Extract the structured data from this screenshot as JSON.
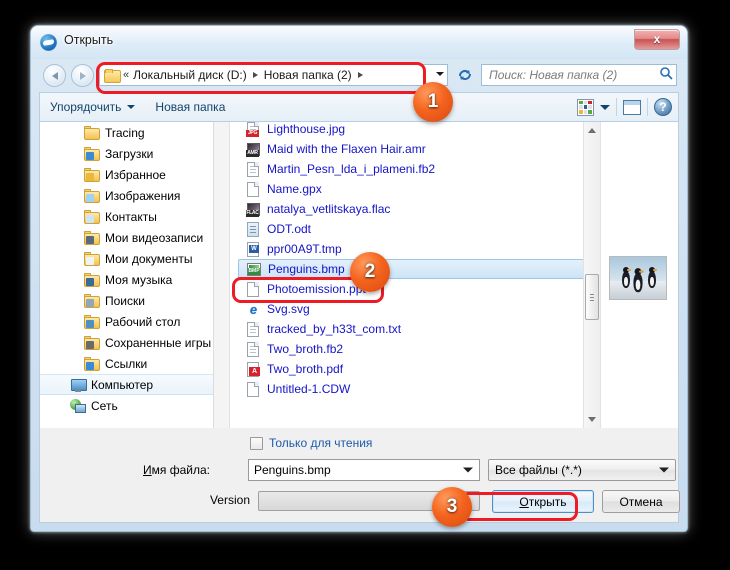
{
  "window": {
    "title": "Открыть",
    "close_label": "x"
  },
  "nav": {
    "back_title": "Назад",
    "forward_title": "Вперед",
    "breadcrumb": {
      "chevrons": "«",
      "items": [
        "Локальный диск (D:)",
        "Новая папка (2)"
      ]
    },
    "refresh_name": "refresh-icon",
    "search_placeholder": "Поиск: Новая папка (2)"
  },
  "toolbar": {
    "organize_label": "Упорядочить",
    "new_folder_label": "Новая папка",
    "views_name": "views-icon",
    "preview_pane_name": "preview-pane-icon",
    "help_label": "?"
  },
  "tree": {
    "items": [
      {
        "label": "Tracing",
        "icon": "folder-icon",
        "selected": false,
        "root": false
      },
      {
        "label": "Загрузки",
        "icon": "folder-downloads-icon",
        "selected": false,
        "root": false
      },
      {
        "label": "Избранное",
        "icon": "folder-favorites-icon",
        "selected": false,
        "root": false
      },
      {
        "label": "Изображения",
        "icon": "folder-pictures-icon",
        "selected": false,
        "root": false
      },
      {
        "label": "Контакты",
        "icon": "folder-contacts-icon",
        "selected": false,
        "root": false
      },
      {
        "label": "Мои видеозаписи",
        "icon": "folder-videos-icon",
        "selected": false,
        "root": false
      },
      {
        "label": "Мои документы",
        "icon": "folder-documents-icon",
        "selected": false,
        "root": false
      },
      {
        "label": "Моя музыка",
        "icon": "folder-music-icon",
        "selected": false,
        "root": false
      },
      {
        "label": "Поиски",
        "icon": "folder-searches-icon",
        "selected": false,
        "root": false
      },
      {
        "label": "Рабочий стол",
        "icon": "folder-desktop-icon",
        "selected": false,
        "root": false
      },
      {
        "label": "Сохраненные игры",
        "icon": "folder-savedgames-icon",
        "selected": false,
        "root": false
      },
      {
        "label": "Ссылки",
        "icon": "folder-links-icon",
        "selected": false,
        "root": false
      },
      {
        "label": "Компьютер",
        "icon": "computer-icon",
        "selected": true,
        "root": true
      },
      {
        "label": "Сеть",
        "icon": "network-icon",
        "selected": false,
        "root": true
      }
    ]
  },
  "files": {
    "items": [
      {
        "name": "Lighthouse.jpg",
        "icon": "jpg-file-icon",
        "ext": "JPG",
        "selected": false
      },
      {
        "name": "Maid with the Flaxen Hair.amr",
        "icon": "amr-file-icon",
        "ext": "AMR",
        "selected": false
      },
      {
        "name": "Martin_Pesn_lda_i_plameni.fb2",
        "icon": "text-file-icon",
        "ext": "",
        "selected": false
      },
      {
        "name": "Name.gpx",
        "icon": "blank-file-icon",
        "ext": "",
        "selected": false
      },
      {
        "name": "natalya_vetlitskaya.flac",
        "icon": "flac-file-icon",
        "ext": "FLAC",
        "selected": false
      },
      {
        "name": "ODT.odt",
        "icon": "odt-file-icon",
        "ext": "",
        "selected": false
      },
      {
        "name": "ppr00A9T.tmp",
        "icon": "tmp-file-icon",
        "ext": "",
        "selected": false
      },
      {
        "name": "Penguins.bmp",
        "icon": "bmp-file-icon",
        "ext": "BMP",
        "selected": true
      },
      {
        "name": "Photoemission.ppt",
        "icon": "blank-file-icon",
        "ext": "",
        "selected": false
      },
      {
        "name": "Svg.svg",
        "icon": "svg-file-icon",
        "ext": "",
        "selected": false
      },
      {
        "name": "tracked_by_h33t_com.txt",
        "icon": "text-file-icon",
        "ext": "",
        "selected": false
      },
      {
        "name": "Two_broth.fb2",
        "icon": "text-file-icon",
        "ext": "",
        "selected": false
      },
      {
        "name": "Two_broth.pdf",
        "icon": "pdf-file-icon",
        "ext": "",
        "selected": false
      },
      {
        "name": "Untitled-1.CDW",
        "icon": "blank-file-icon",
        "ext": "",
        "selected": false
      }
    ]
  },
  "preview": {
    "alt": "Penguins preview thumbnail"
  },
  "options": {
    "readonly_label": "Только для чтения"
  },
  "footer": {
    "filename_label_pre": "И",
    "filename_label_post": "мя файла:",
    "filename_value": "Penguins.bmp",
    "filter_value": "Все файлы (*.*)",
    "version_label": "Version",
    "version_value": "",
    "open_label_pre": "О",
    "open_label_post": "ткрыть",
    "cancel_label": "Отмена"
  },
  "annotations": {
    "badges": [
      {
        "number": "1"
      },
      {
        "number": "2"
      },
      {
        "number": "3"
      }
    ],
    "accent_color": "#ee1b24",
    "badge_color": "#f4641e"
  }
}
